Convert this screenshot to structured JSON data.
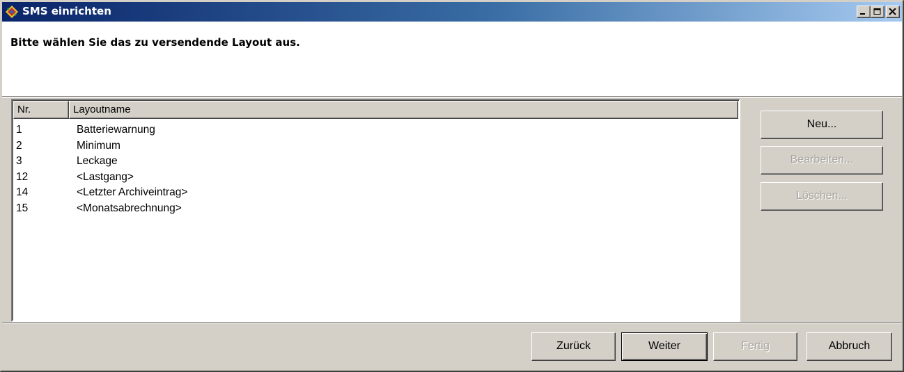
{
  "window": {
    "title": "SMS einrichten",
    "icon": "app-diamond-icon"
  },
  "header": {
    "instruction": "Bitte wählen Sie das zu versendende Layout aus."
  },
  "list": {
    "columns": [
      "Nr.",
      "Layoutname"
    ],
    "rows": [
      {
        "nr": "1",
        "name": "Batteriewarnung"
      },
      {
        "nr": "2",
        "name": "Minimum"
      },
      {
        "nr": "3",
        "name": "Leckage"
      },
      {
        "nr": "12",
        "name": "<Lastgang>"
      },
      {
        "nr": "14",
        "name": "<Letzter Archiveintrag>"
      },
      {
        "nr": "15",
        "name": "<Monatsabrechnung>"
      }
    ]
  },
  "side_buttons": {
    "new": "Neu...",
    "edit": "Bearbeiten...",
    "delete": "Löschen..."
  },
  "footer_buttons": {
    "back": "Zurück",
    "next": "Weiter",
    "finish": "Fertig",
    "cancel": "Abbruch"
  },
  "colors": {
    "titlebar_start": "#0a246a",
    "titlebar_end": "#a6caf0",
    "face": "#d4d0c8",
    "disabled_text": "#a9a6a0"
  }
}
